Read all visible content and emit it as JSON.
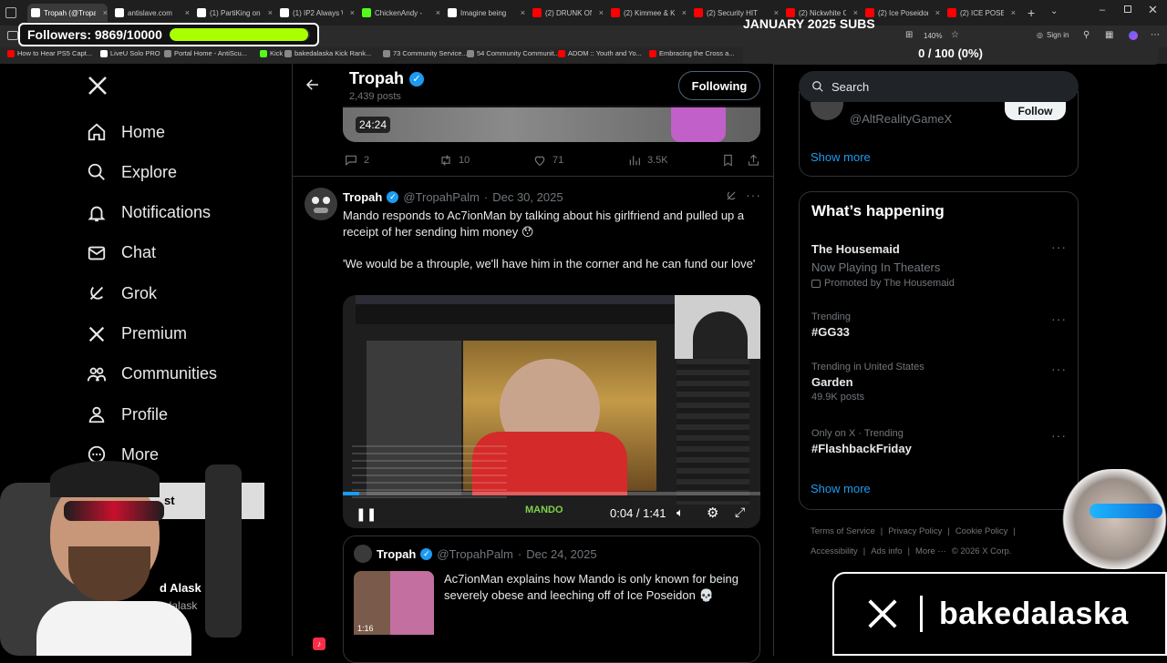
{
  "browser": {
    "tabs": [
      {
        "label": "Tropah (@Tropa",
        "color": "#ffffff",
        "active": true
      },
      {
        "label": "antislave.com",
        "color": "#ffffff"
      },
      {
        "label": "(1) PartiKing on",
        "color": "#ffffff"
      },
      {
        "label": "(1) IP2 Always W",
        "color": "#ffffff"
      },
      {
        "label": "ChickenAndy -",
        "color": "#53fc18"
      },
      {
        "label": "Imagine being",
        "color": "#ffffff"
      },
      {
        "label": "(2) DRUNK ONL",
        "color": "#ff0000"
      },
      {
        "label": "(2) Kimmee & K",
        "color": "#ff0000"
      },
      {
        "label": "(2) Security HIT",
        "color": "#ff0000"
      },
      {
        "label": "(2) Nickwhite G",
        "color": "#ff0000"
      },
      {
        "label": "(2) Ice Poseidon",
        "color": "#ff0000"
      },
      {
        "label": "(2) ICE POSEIDO",
        "color": "#ff0000"
      }
    ],
    "zoom": "140%",
    "signin": "Sign in",
    "bookmarks": [
      {
        "label": "How to Hear PS5 Capt...",
        "color": "#ff0000"
      },
      {
        "label": "LiveU Solo PRO",
        "color": "#ffffff"
      },
      {
        "label": "Portal Home - AntiScu...",
        "color": "#888888"
      },
      {
        "label": "Kick",
        "color": "#53fc18"
      },
      {
        "label": "bakedalaska Kick Rank...",
        "color": "#888888"
      },
      {
        "label": "73 Community Service...",
        "color": "#888888"
      },
      {
        "label": "54 Community Communit...",
        "color": "#888888"
      },
      {
        "label": "ADOM :: Youth and Yo...",
        "color": "#ff0000"
      },
      {
        "label": "Embracing the Cross a...",
        "color": "#ff0000"
      }
    ]
  },
  "overlay": {
    "followers_label": "Followers: 9869/10000",
    "followers_progress": 0.9869,
    "subs_title": "JANUARY 2025 SUBS",
    "subs_progress_text": "0 / 100 (0%)",
    "brand_name": "bakedalaska",
    "webcam_partial_text": "st",
    "webcam_partial_name": "d Alask",
    "webcam_partial_handle": "edalask"
  },
  "nav": {
    "items": [
      {
        "label": "Home",
        "icon": "home-icon"
      },
      {
        "label": "Explore",
        "icon": "search-icon"
      },
      {
        "label": "Notifications",
        "icon": "bell-icon"
      },
      {
        "label": "Chat",
        "icon": "mail-icon"
      },
      {
        "label": "Grok",
        "icon": "grok-icon"
      },
      {
        "label": "Premium",
        "icon": "x-logo-icon"
      },
      {
        "label": "Communities",
        "icon": "people-icon"
      },
      {
        "label": "Profile",
        "icon": "person-icon"
      },
      {
        "label": "More",
        "icon": "more-icon"
      }
    ]
  },
  "profile_header": {
    "name": "Tropah",
    "posts": "2,439 posts",
    "follow_state": "Following"
  },
  "prev_tweet": {
    "duration": "24:24",
    "replies": "2",
    "retweets": "10",
    "likes": "71",
    "views": "3.5K"
  },
  "tweet": {
    "name": "Tropah",
    "handle": "@TropahPalm",
    "date": "Dec 30, 2025",
    "text1": "Mando responds to Ac7ionMan by talking about his girlfriend and pulled up a receipt of her sending him money 😯",
    "text2": "'We would be a throuple, we'll have him in the corner and he can fund our love'",
    "video_time": "0:04 / 1:41",
    "video_progress": 0.04,
    "video_watermark": "MANDO"
  },
  "quoted": {
    "name": "Tropah",
    "handle": "@TropahPalm",
    "date": "Dec 24, 2025",
    "text": "Ac7ionMan explains how Mando is only known for being severely obese and leeching off of Ice Poseidon 💀",
    "duration": "1:16"
  },
  "sidebar": {
    "search_placeholder": "Search",
    "suggest_handle": "@AltRealityGameX",
    "follow_label": "Follow",
    "show_more": "Show more",
    "happening_title": "What’s happening",
    "trends": [
      {
        "title": "The Housemaid",
        "sub": "Now Playing In Theaters",
        "meta": "Promoted by The Housemaid"
      },
      {
        "context": "Trending",
        "title": "#GG33"
      },
      {
        "context": "Trending in United States",
        "title": "Garden",
        "meta": "49.9K posts"
      },
      {
        "context": "Only on X · Trending",
        "title": "#FlashbackFriday"
      }
    ],
    "show_more2": "Show more",
    "footer": [
      "Terms of Service",
      "Privacy Policy",
      "Cookie Policy",
      "Accessibility",
      "Ads info",
      "More ···",
      "© 2026 X Corp."
    ]
  }
}
